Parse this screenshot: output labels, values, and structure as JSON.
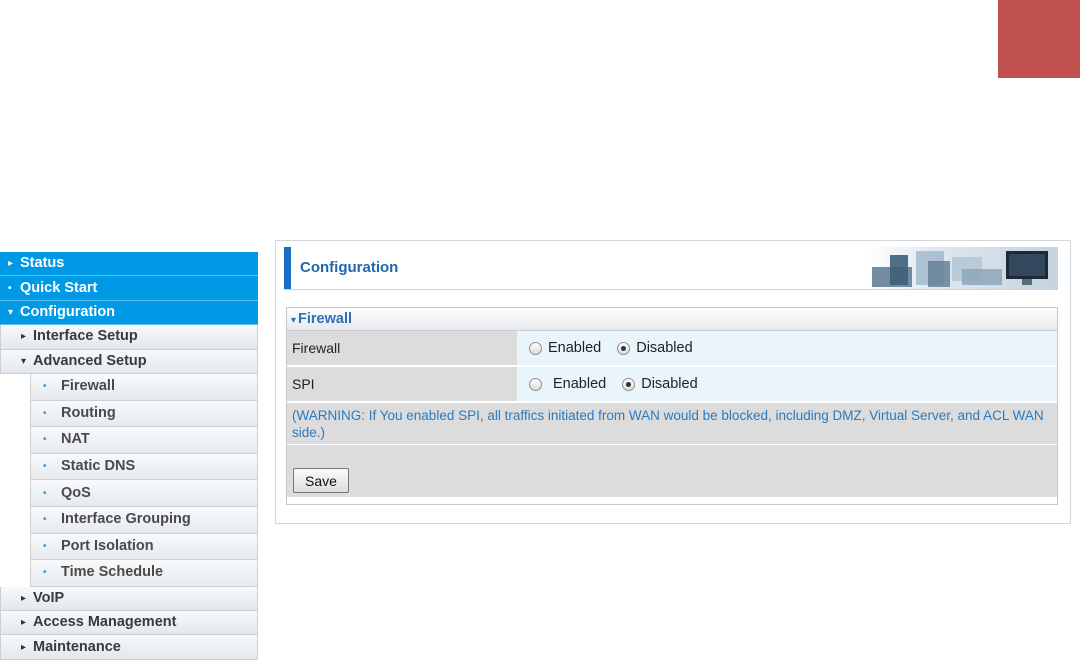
{
  "sidebar": {
    "items": [
      {
        "label": "Status",
        "marker": "▸"
      },
      {
        "label": "Quick Start",
        "marker": "•"
      },
      {
        "label": "Configuration",
        "marker": "▾"
      },
      {
        "label": "Interface Setup",
        "marker": "▸"
      },
      {
        "label": "Advanced Setup",
        "marker": "▾"
      },
      {
        "label": "Firewall",
        "marker": "•"
      },
      {
        "label": "Routing",
        "marker": "•"
      },
      {
        "label": "NAT",
        "marker": "•"
      },
      {
        "label": "Static DNS",
        "marker": "•"
      },
      {
        "label": "QoS",
        "marker": "•"
      },
      {
        "label": "Interface Grouping",
        "marker": "•"
      },
      {
        "label": "Port Isolation",
        "marker": "•"
      },
      {
        "label": "Time Schedule",
        "marker": "•"
      },
      {
        "label": "VoIP",
        "marker": "▸"
      },
      {
        "label": "Access Management",
        "marker": "▸"
      },
      {
        "label": "Maintenance",
        "marker": "▸"
      }
    ]
  },
  "header": {
    "title": "Configuration"
  },
  "section": {
    "title": "Firewall",
    "marker": "▾",
    "rows": [
      {
        "label": "Firewall",
        "options": [
          "Enabled",
          "Disabled"
        ],
        "selected": "Disabled"
      },
      {
        "label": "SPI",
        "options": [
          "Enabled",
          "Disabled"
        ],
        "selected": "Disabled"
      }
    ],
    "warning": "(WARNING: If You enabled SPI, all traffics initiated from WAN would be blocked, including DMZ, Virtual Server, and ACL WAN side.)",
    "save_label": "Save"
  },
  "colors": {
    "nav_top": "#0099e6",
    "accent_title": "#2166ac",
    "warning_text": "#2a7bc0",
    "corner_block": "#c0504d"
  }
}
